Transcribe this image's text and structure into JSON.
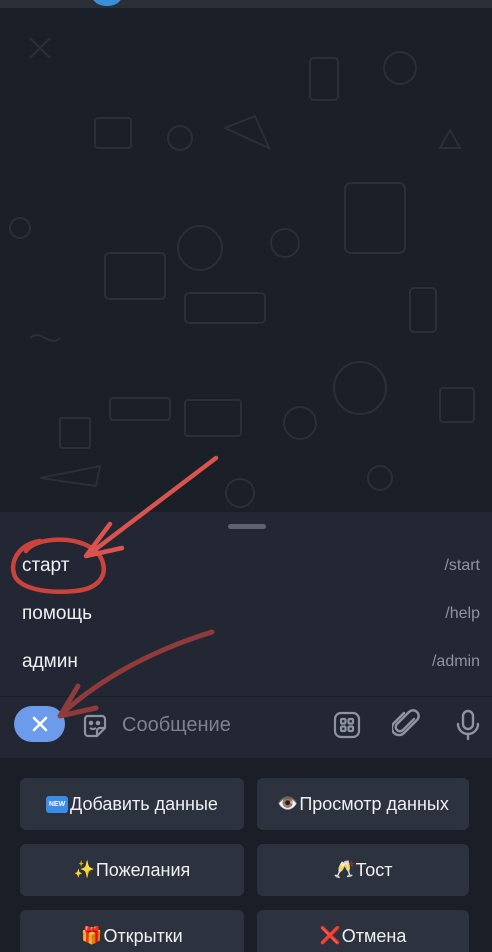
{
  "commands": [
    {
      "name": "старт",
      "code": "/start"
    },
    {
      "name": "помощь",
      "code": "/help"
    },
    {
      "name": "админ",
      "code": "/admin"
    }
  ],
  "input": {
    "placeholder": "Сообщение"
  },
  "keyboard": {
    "add_data": {
      "icon": "new-icon",
      "badge": "NEW",
      "label": "Добавить данные"
    },
    "view_data": {
      "icon": "eye-icon",
      "emoji": "👁️",
      "label": "Просмотр данных"
    },
    "wishes": {
      "icon": "sparkles-icon",
      "emoji": "✨",
      "label": "Пожелания"
    },
    "toast": {
      "icon": "champagne-icon",
      "emoji": "🥂",
      "label": "Тост"
    },
    "cards": {
      "icon": "gift-icon",
      "emoji": "🎁",
      "label": "Открытки"
    },
    "cancel": {
      "icon": "cross-mark-icon",
      "emoji": "❌",
      "label": "Отмена"
    }
  },
  "colors": {
    "wallpaper": "#1b1f27",
    "panel": "#232733",
    "accent": "#6b9bea",
    "annotation": "#d9534f"
  }
}
